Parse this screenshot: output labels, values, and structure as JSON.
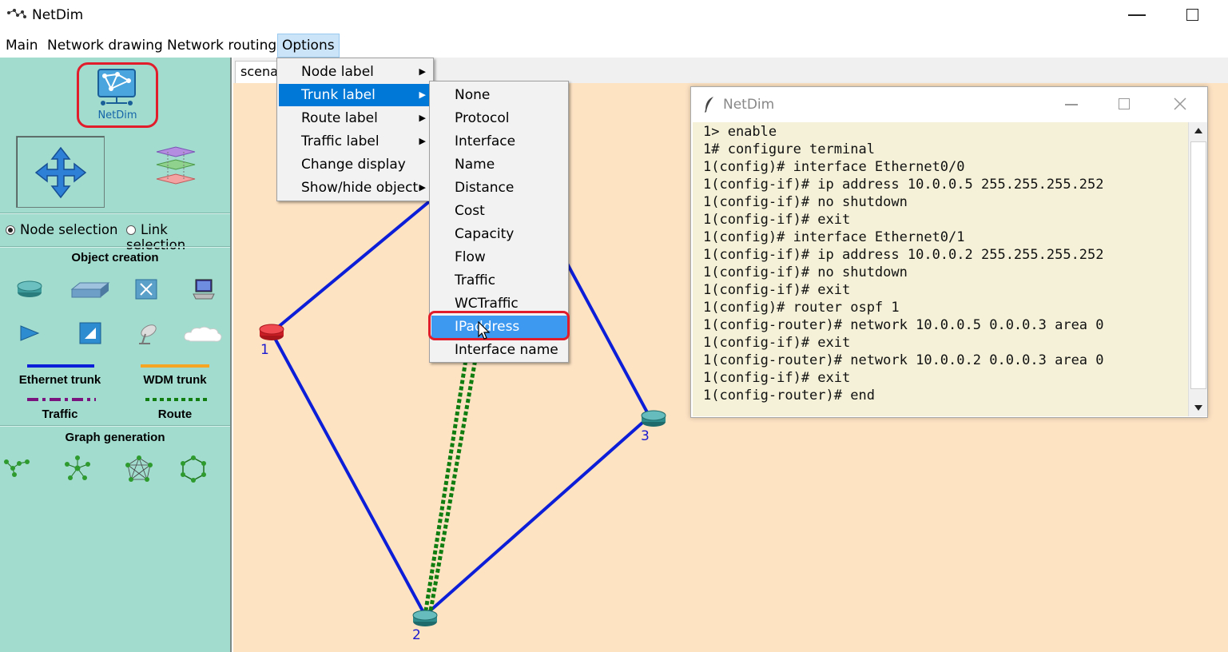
{
  "app": {
    "title": "NetDim"
  },
  "menubar": {
    "items": [
      "Main",
      "Network drawing",
      "Network routing",
      "Options"
    ]
  },
  "sidebar": {
    "logo_text": "NetDim",
    "radio_node": "Node selection",
    "radio_link": "Link selection",
    "object_creation_title": "Object creation",
    "legend": {
      "ethernet": "Ethernet trunk",
      "wdm": "WDM trunk",
      "traffic": "Traffic",
      "route": "Route"
    },
    "graph_generation_title": "Graph generation",
    "colors": {
      "ethernet": "#0d1ed8",
      "wdm": "#f5a521",
      "traffic": "#7a137d",
      "route": "#0f7d0f"
    }
  },
  "tab": {
    "label": "scenar"
  },
  "network": {
    "nodes": [
      {
        "label": "1",
        "type": "router",
        "color": "#e8222b"
      },
      {
        "label": "2",
        "type": "router",
        "color": "#2f8c8c"
      },
      {
        "label": "3",
        "type": "router",
        "color": "#2f8c8c"
      }
    ]
  },
  "options_menu": {
    "items": [
      {
        "label": "Node label",
        "submenu": true
      },
      {
        "label": "Trunk label",
        "submenu": true,
        "selected": true
      },
      {
        "label": "Route label",
        "submenu": true
      },
      {
        "label": "Traffic label",
        "submenu": true
      },
      {
        "label": "Change display",
        "submenu": false
      },
      {
        "label": "Show/hide object",
        "submenu": true
      }
    ]
  },
  "trunk_label_submenu": {
    "items": [
      "None",
      "Protocol",
      "Interface",
      "Name",
      "Distance",
      "Cost",
      "Capacity",
      "Flow",
      "Traffic",
      "WCTraffic",
      "IPaddress",
      "Interface name"
    ],
    "highlighted": "IPaddress"
  },
  "terminal": {
    "title": "NetDim",
    "lines": [
      "1> enable",
      "1# configure terminal",
      "1(config)# interface Ethernet0/0",
      "1(config-if)# ip address 10.0.0.5 255.255.255.252",
      "1(config-if)# no shutdown",
      "1(config-if)# exit",
      "1(config)# interface Ethernet0/1",
      "1(config-if)# ip address 10.0.0.2 255.255.255.252",
      "1(config-if)# no shutdown",
      "1(config-if)# exit",
      "1(config)# router ospf 1",
      "1(config-router)# network 10.0.0.5 0.0.0.3 area 0",
      "1(config-if)# exit",
      "1(config-router)# network 10.0.0.2 0.0.0.3 area 0",
      "1(config-if)# exit",
      "1(config-router)# end"
    ]
  }
}
